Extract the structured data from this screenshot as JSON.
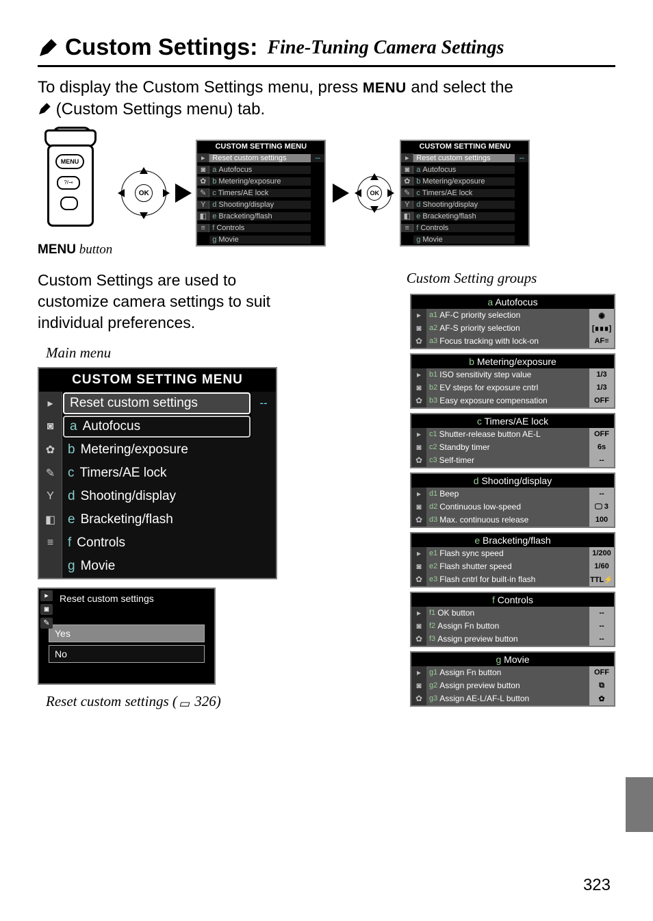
{
  "page_number": "323",
  "title": {
    "heading": "Custom Settings:",
    "italic": "Fine-Tuning Camera Settings"
  },
  "intro_parts": {
    "a": "To display the Custom Settings menu, press ",
    "menu": "MENU",
    "b": " and select the ",
    "c": " (Custom Settings menu) tab."
  },
  "menu_button_caption": {
    "bold": "MENU",
    "italic": " button"
  },
  "mini_menu_header": "CUSTOM SETTING MENU",
  "mini_menu_items": [
    {
      "pre": "",
      "label": "Reset custom settings",
      "val": "--",
      "hilite": true
    },
    {
      "pre": "a",
      "label": "Autofocus",
      "val": ""
    },
    {
      "pre": "b",
      "label": "Metering/exposure",
      "val": ""
    },
    {
      "pre": "c",
      "label": "Timers/AE lock",
      "val": ""
    },
    {
      "pre": "d",
      "label": "Shooting/display",
      "val": ""
    },
    {
      "pre": "e",
      "label": "Bracketing/flash",
      "val": ""
    },
    {
      "pre": "f",
      "label": "Controls",
      "val": ""
    },
    {
      "pre": "g",
      "label": "Movie",
      "val": ""
    }
  ],
  "intro2": "Custom Settings are used to customize camera settings to suit individual preferences.",
  "main_menu_label": "Main menu",
  "main_menu_header": "CUSTOM SETTING MENU",
  "main_menu_items": [
    {
      "pre": "",
      "label": "Reset custom settings",
      "val": "--",
      "style": "boxed"
    },
    {
      "pre": "a",
      "label": "Autofocus",
      "val": "",
      "style": "boxed2"
    },
    {
      "pre": "b",
      "label": "Metering/exposure",
      "val": ""
    },
    {
      "pre": "c",
      "label": "Timers/AE lock",
      "val": ""
    },
    {
      "pre": "d",
      "label": "Shooting/display",
      "val": ""
    },
    {
      "pre": "e",
      "label": "Bracketing/flash",
      "val": ""
    },
    {
      "pre": "f",
      "label": "Controls",
      "val": ""
    },
    {
      "pre": "g",
      "label": "Movie",
      "val": ""
    }
  ],
  "reset_panel": {
    "header": "Reset custom settings",
    "yes": "Yes",
    "no": "No"
  },
  "reset_caption_a": "Reset custom settings (",
  "reset_caption_b": " 326)",
  "groups_label": "Custom Setting groups",
  "groups": [
    {
      "hdr_pre": "a",
      "hdr": "Autofocus",
      "rows": [
        {
          "pre": "a1",
          "label": "AF-C priority selection",
          "val": "◉"
        },
        {
          "pre": "a2",
          "label": "AF-S priority selection",
          "val": "[∎∎∎]"
        },
        {
          "pre": "a3",
          "label": "Focus tracking with lock-on",
          "val": "AF≡"
        }
      ]
    },
    {
      "hdr_pre": "b",
      "hdr": "Metering/exposure",
      "rows": [
        {
          "pre": "b1",
          "label": "ISO sensitivity step value",
          "val": "1/3"
        },
        {
          "pre": "b2",
          "label": "EV steps for exposure cntrl",
          "val": "1/3"
        },
        {
          "pre": "b3",
          "label": "Easy exposure compensation",
          "val": "OFF"
        }
      ]
    },
    {
      "hdr_pre": "c",
      "hdr": "Timers/AE lock",
      "rows": [
        {
          "pre": "c1",
          "label": "Shutter-release button AE-L",
          "val": "OFF"
        },
        {
          "pre": "c2",
          "label": "Standby timer",
          "val": "6s"
        },
        {
          "pre": "c3",
          "label": "Self-timer",
          "val": "--"
        }
      ]
    },
    {
      "hdr_pre": "d",
      "hdr": "Shooting/display",
      "rows": [
        {
          "pre": "d1",
          "label": "Beep",
          "val": "--"
        },
        {
          "pre": "d2",
          "label": "Continuous low-speed",
          "val": "🖵 3"
        },
        {
          "pre": "d3",
          "label": "Max. continuous release",
          "val": "100"
        }
      ]
    },
    {
      "hdr_pre": "e",
      "hdr": "Bracketing/flash",
      "rows": [
        {
          "pre": "e1",
          "label": "Flash sync speed",
          "val": "1/200"
        },
        {
          "pre": "e2",
          "label": "Flash shutter speed",
          "val": "1/60"
        },
        {
          "pre": "e3",
          "label": "Flash cntrl for built-in flash",
          "val": "TTL⚡"
        }
      ]
    },
    {
      "hdr_pre": "f",
      "hdr": "Controls",
      "rows": [
        {
          "pre": "f1",
          "label": "OK button",
          "val": "--"
        },
        {
          "pre": "f2",
          "label": "Assign Fn button",
          "val": "--"
        },
        {
          "pre": "f3",
          "label": "Assign preview button",
          "val": "--"
        }
      ]
    },
    {
      "hdr_pre": "g",
      "hdr": "Movie",
      "rows": [
        {
          "pre": "g1",
          "label": "Assign Fn button",
          "val": "OFF"
        },
        {
          "pre": "g2",
          "label": "Assign preview button",
          "val": "⧉"
        },
        {
          "pre": "g3",
          "label": "Assign AE-L/AF-L button",
          "val": "✿"
        }
      ]
    }
  ],
  "ok_label": "OK",
  "menu_label_small": "MENU"
}
